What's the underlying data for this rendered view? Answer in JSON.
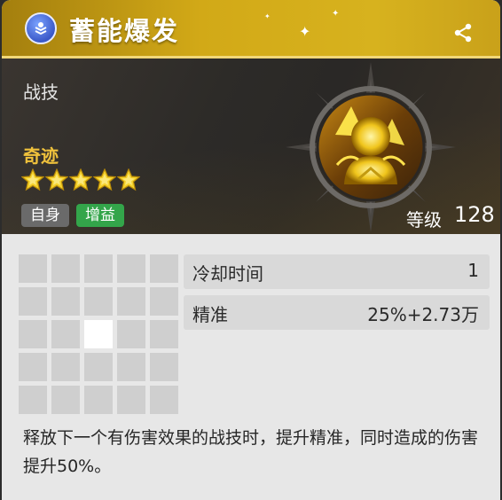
{
  "skill": {
    "name": "蓄能爆发",
    "type": "战技",
    "rarity": "奇迹",
    "star_count": 5,
    "tags": [
      "自身",
      "增益"
    ],
    "level_label": "等级",
    "level_value": "128"
  },
  "stats": [
    {
      "label": "冷却时间",
      "value": "1"
    },
    {
      "label": "精准",
      "value": "25%+2.73万"
    }
  ],
  "range_grid": {
    "rows": 5,
    "cols": 5,
    "active_cells": [
      [
        2,
        2
      ]
    ]
  },
  "description": "释放下一个有伤害效果的战技时，提升精准，同时造成的伤害提升50%。",
  "icons": {
    "title": "skill-type-icon",
    "share": "share-icon",
    "emblem": "skill-emblem-icon",
    "star": "star-icon"
  },
  "colors": {
    "title_gold": "#d2a917",
    "rarity": "#f0c23c",
    "tag_buff": "#33a54a",
    "tag_self": "#6a6a6a"
  }
}
